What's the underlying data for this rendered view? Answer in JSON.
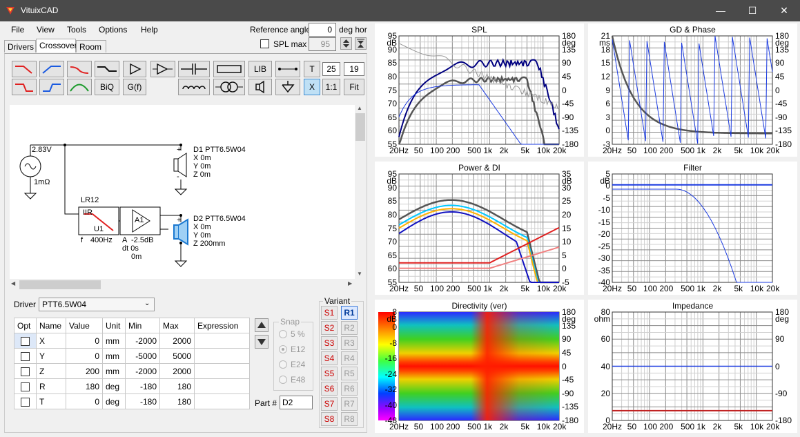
{
  "window": {
    "title": "VituixCAD",
    "min": "—",
    "max": "☐",
    "close": "✕"
  },
  "menu": [
    "File",
    "View",
    "Tools",
    "Options",
    "Help"
  ],
  "tabs": [
    "Drivers",
    "Crossover",
    "Room"
  ],
  "ref": {
    "label": "Reference angle",
    "value": "0",
    "unit": "deg hor",
    "spl_max_label": "SPL max",
    "spl_max_value": "95"
  },
  "toolbar": {
    "lib": "LIB",
    "t": "T",
    "t_val": "25",
    "t_val2": "19",
    "biq": "BiQ",
    "gf": "G(f)",
    "x": "X",
    "one": "1:1",
    "fit": "Fit"
  },
  "schematic": {
    "source_v": "2.83V",
    "source_r": "1mΩ",
    "d1": {
      "name": "D1 PTT6.5W04",
      "x": "X 0m",
      "y": "Y 0m",
      "z": "Z 0m"
    },
    "d2": {
      "name": "D2 PTT6.5W04",
      "x": "X 0m",
      "y": "Y 0m",
      "z": "Z 200mm"
    },
    "filter": {
      "type": "LR12",
      "sub": "IIR",
      "id": "U1",
      "f_label": "f",
      "f": "400Hz"
    },
    "amp": {
      "id": "A1",
      "a_label": "A",
      "gain": "-2.5dB",
      "dt": "dt 0s",
      "dt2": "0m"
    }
  },
  "driver": {
    "label": "Driver",
    "value": "PTT6.5W04"
  },
  "table": {
    "headers": [
      "Opt",
      "Name",
      "Value",
      "Unit",
      "Min",
      "Max",
      "Expression"
    ],
    "rows": [
      {
        "name": "X",
        "value": "0",
        "unit": "mm",
        "min": "-2000",
        "max": "2000"
      },
      {
        "name": "Y",
        "value": "0",
        "unit": "mm",
        "min": "-5000",
        "max": "5000"
      },
      {
        "name": "Z",
        "value": "200",
        "unit": "mm",
        "min": "-2000",
        "max": "2000"
      },
      {
        "name": "R",
        "value": "180",
        "unit": "deg",
        "min": "-180",
        "max": "180"
      },
      {
        "name": "T",
        "value": "0",
        "unit": "deg",
        "min": "-180",
        "max": "180"
      }
    ]
  },
  "snap": {
    "label": "Snap",
    "options": [
      "5 %",
      "E12",
      "E24",
      "E48"
    ]
  },
  "part": {
    "label": "Part #",
    "value": "D2"
  },
  "variant": {
    "label": "Variant",
    "s": [
      "S1",
      "S2",
      "S3",
      "S4",
      "S5",
      "S6",
      "S7",
      "S8"
    ],
    "r": [
      "R1",
      "R2",
      "R3",
      "R4",
      "R5",
      "R6",
      "R7",
      "R8"
    ]
  },
  "charts": {
    "spl": {
      "title": "SPL",
      "yl": [
        "95",
        "dB",
        "90",
        "85",
        "80",
        "75",
        "70",
        "65",
        "60",
        "55"
      ],
      "yr": [
        "180",
        "deg",
        "135",
        "90",
        "45",
        "0",
        "-45",
        "-90",
        "-135",
        "-180"
      ]
    },
    "gd": {
      "title": "GD & Phase",
      "yl": [
        "21",
        "ms",
        "18",
        "15",
        "12",
        "9",
        "6",
        "3",
        "0",
        "-3"
      ],
      "yr": [
        "180",
        "deg",
        "135",
        "90",
        "45",
        "0",
        "-45",
        "-90",
        "-135",
        "-180"
      ]
    },
    "power": {
      "title": "Power & DI",
      "yl": [
        "95",
        "dB",
        "90",
        "85",
        "80",
        "75",
        "70",
        "65",
        "60",
        "55"
      ],
      "yr": [
        "35",
        "dB",
        "30",
        "25",
        "20",
        "15",
        "10",
        "5",
        "0",
        "-5"
      ]
    },
    "filter": {
      "title": "Filter",
      "yl": [
        "5",
        "dB",
        "0",
        "-5",
        "-10",
        "-15",
        "-20",
        "-25",
        "-30",
        "-35",
        "-40"
      ]
    },
    "dir": {
      "title": "Directivity (ver)",
      "yl": [
        "8",
        "dB",
        "0",
        "-8",
        "-16",
        "-24",
        "-32",
        "-40",
        "-48"
      ],
      "yr": [
        "180",
        "deg",
        "135",
        "90",
        "45",
        "0",
        "-45",
        "-90",
        "-135",
        "-180"
      ]
    },
    "imp": {
      "title": "Impedance",
      "yl": [
        "80",
        "ohm",
        "60",
        "40",
        "20",
        "0"
      ],
      "yr": [
        "180",
        "deg",
        "90",
        "0",
        "-90",
        "-180"
      ]
    },
    "xticks": [
      "20Hz",
      "50",
      "100",
      "200",
      "500",
      "1k",
      "2k",
      "5k",
      "10k",
      "20k"
    ]
  }
}
